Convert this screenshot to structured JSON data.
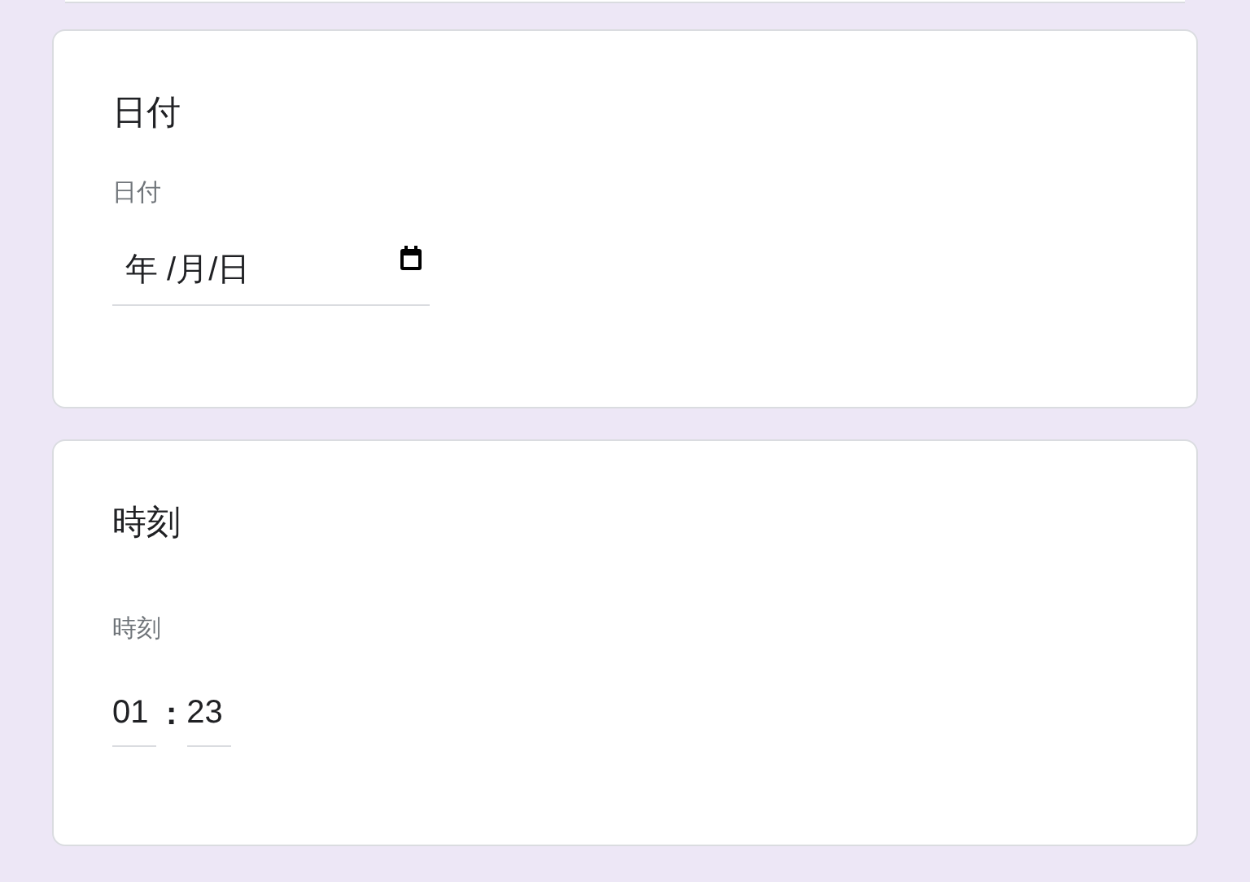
{
  "questions": [
    {
      "kind": "date",
      "title": "日付",
      "label": "日付",
      "value": "年 /月/日"
    },
    {
      "kind": "time",
      "title": "時刻",
      "label": "時刻",
      "hours": "01",
      "separator": ":",
      "minutes": "23"
    }
  ]
}
